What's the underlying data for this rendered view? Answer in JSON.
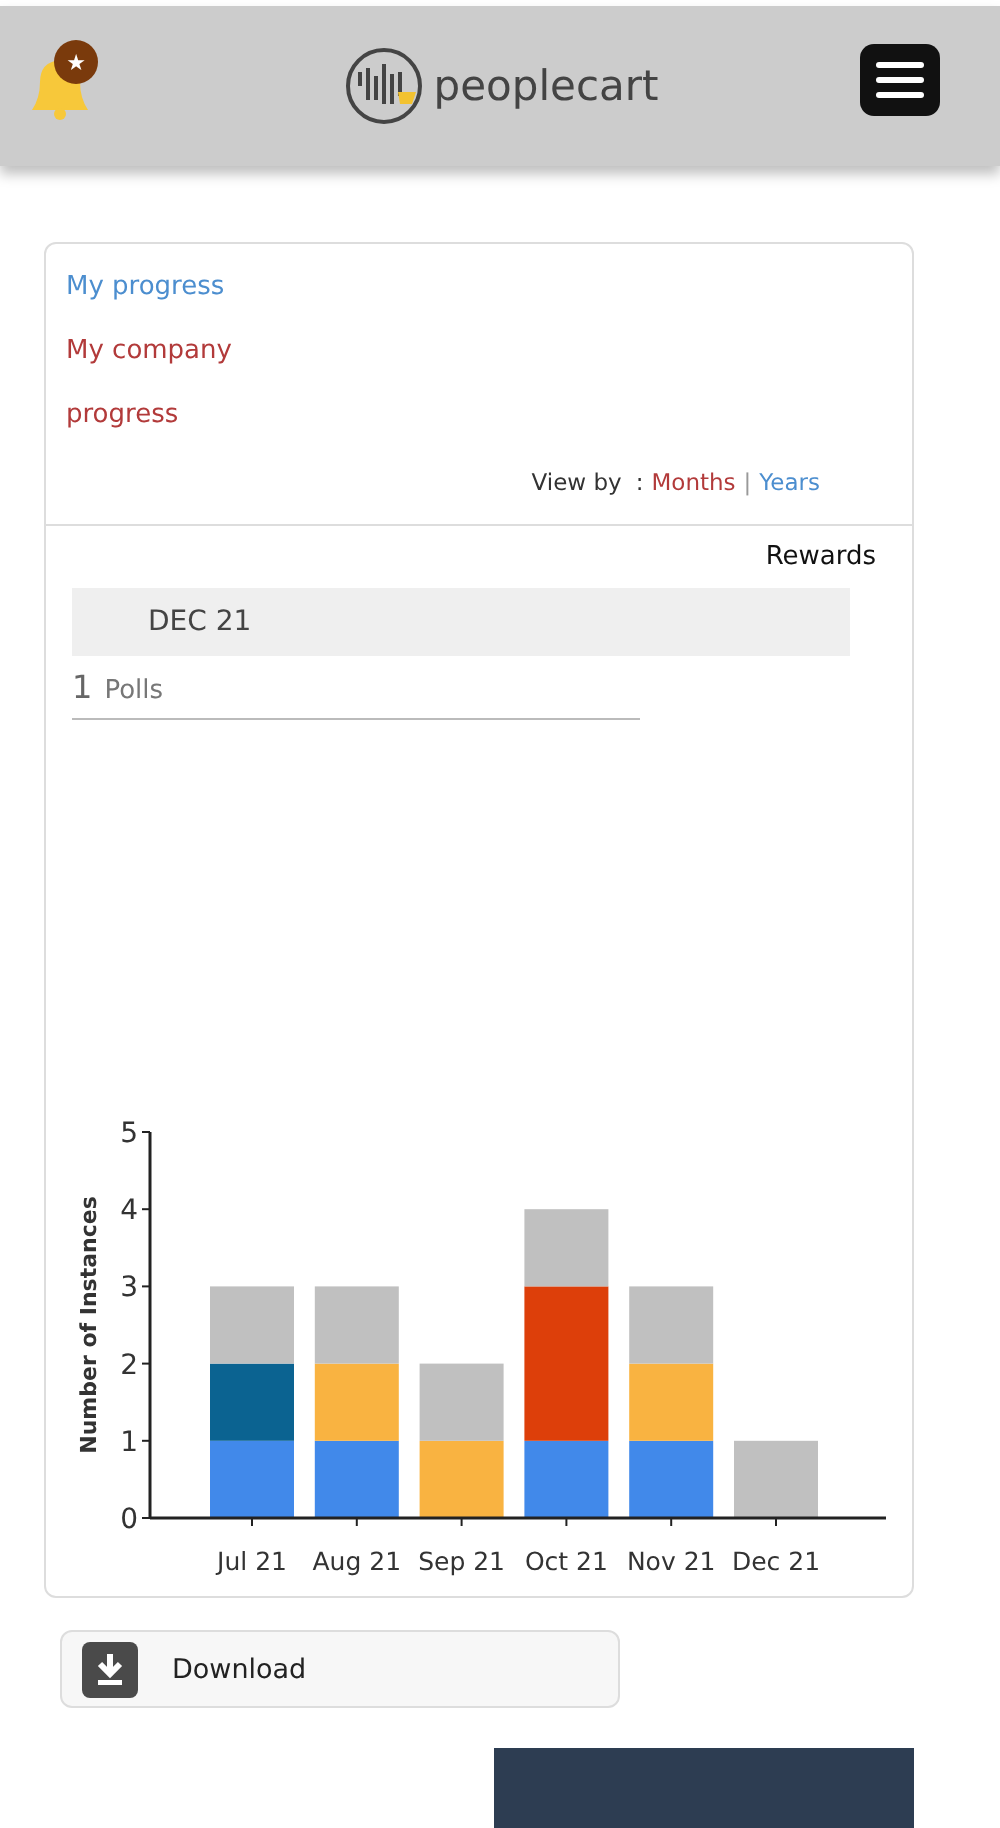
{
  "header": {
    "logo_text": "peoplecart",
    "badge": "★"
  },
  "tabs": [
    {
      "label": "My progress",
      "selected": false
    },
    {
      "label": "My company progress",
      "selected": true
    }
  ],
  "view_by": {
    "label": "View by",
    "separator": ":",
    "divider": "|",
    "options": [
      {
        "label": "Months",
        "selected": true
      },
      {
        "label": "Years",
        "selected": false
      }
    ]
  },
  "rewards_link": "Rewards",
  "period": "DEC 21",
  "summary": {
    "count": "1",
    "label": "Polls"
  },
  "chart_data": {
    "type": "bar",
    "stacked": true,
    "ylabel": "Number of Instances",
    "categories": [
      "Jul 21",
      "Aug 21",
      "Sep 21",
      "Oct 21",
      "Nov 21",
      "Dec 21"
    ],
    "ylim": [
      0,
      5
    ],
    "yticks": [
      0,
      1,
      2,
      3,
      4,
      5
    ],
    "series": [
      {
        "color": "#4189ea",
        "values": [
          1,
          1,
          0,
          1,
          1,
          0
        ]
      },
      {
        "color": "#0b6391",
        "values": [
          1,
          0,
          0,
          0,
          0,
          0
        ]
      },
      {
        "color": "#f9b341",
        "values": [
          0,
          1,
          1,
          0,
          1,
          0
        ]
      },
      {
        "color": "#dd3f0a",
        "values": [
          0,
          0,
          0,
          2,
          0,
          0
        ]
      },
      {
        "color": "#c0c0c0",
        "values": [
          1,
          1,
          1,
          1,
          1,
          1
        ]
      }
    ]
  },
  "download_button": "Download"
}
